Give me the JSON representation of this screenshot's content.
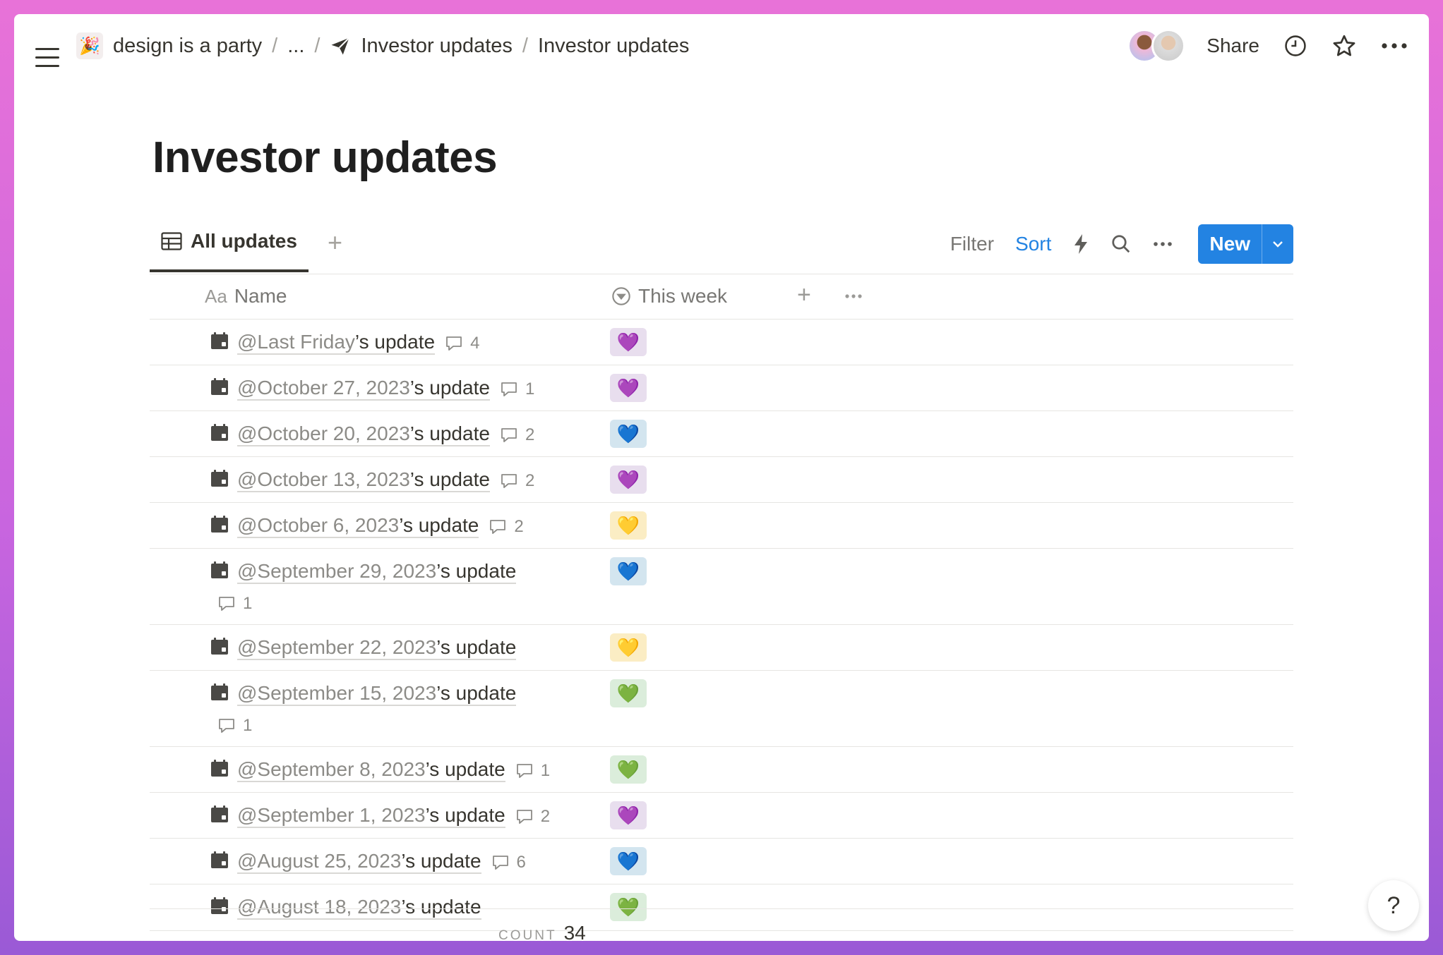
{
  "topbar": {
    "workspace": "design is a party",
    "ellipsis": "...",
    "crumb_parent": "Investor updates",
    "crumb_current": "Investor updates",
    "share": "Share"
  },
  "page": {
    "title": "Investor updates"
  },
  "view": {
    "tab": "All updates",
    "filter": "Filter",
    "sort": "Sort",
    "new": "New"
  },
  "table": {
    "headers": {
      "name_prefix": "Aa",
      "name": "Name",
      "week": "This week"
    },
    "rows": [
      {
        "mention": "@Last Friday",
        "suffix": "’s update",
        "comments": "4",
        "heart": "purple",
        "emoji": "💜"
      },
      {
        "mention": "@October 27, 2023",
        "suffix": "’s update",
        "comments": "1",
        "heart": "purple",
        "emoji": "💜"
      },
      {
        "mention": "@October 20, 2023",
        "suffix": "’s update",
        "comments": "2",
        "heart": "blue",
        "emoji": "💙"
      },
      {
        "mention": "@October 13, 2023",
        "suffix": "’s update",
        "comments": "2",
        "heart": "purple",
        "emoji": "💜"
      },
      {
        "mention": "@October 6, 2023",
        "suffix": "’s update",
        "comments": "2",
        "heart": "yellow",
        "emoji": "💛"
      },
      {
        "mention": "@September 29, 2023",
        "suffix": "’s update",
        "comments": "1",
        "heart": "blue",
        "emoji": "💙"
      },
      {
        "mention": "@September 22, 2023",
        "suffix": "’s update",
        "comments": "",
        "heart": "yellow",
        "emoji": "💛"
      },
      {
        "mention": "@September 15, 2023",
        "suffix": "’s update",
        "comments": "1",
        "heart": "green",
        "emoji": "💚"
      },
      {
        "mention": "@September 8, 2023",
        "suffix": "’s update",
        "comments": "1",
        "heart": "green",
        "emoji": "💚"
      },
      {
        "mention": "@September 1, 2023",
        "suffix": "’s update",
        "comments": "2",
        "heart": "purple",
        "emoji": "💜"
      },
      {
        "mention": "@August 25, 2023",
        "suffix": "’s update",
        "comments": "6",
        "heart": "blue",
        "emoji": "💙"
      },
      {
        "mention": "@August 18, 2023",
        "suffix": "’s update",
        "comments": "",
        "heart": "green",
        "emoji": "💚"
      }
    ]
  },
  "footer": {
    "count_label": "COUNT",
    "count_value": "34"
  },
  "help": "?",
  "icons": {
    "menu": "hamburger-menu-icon",
    "workspace": "party-popper-icon",
    "breadcrumb_page": "paper-plane-icon",
    "history": "clock-icon",
    "favorite": "star-icon",
    "more": "more-horizontal-icon",
    "view": "table-icon",
    "automation": "lightning-icon",
    "search": "search-icon",
    "row": "calendar-icon",
    "comment": "comment-icon",
    "status": "chevron-circle-icon"
  },
  "colors": {
    "accent": "#2383e2",
    "text": "#37352f",
    "muted": "#787774"
  }
}
